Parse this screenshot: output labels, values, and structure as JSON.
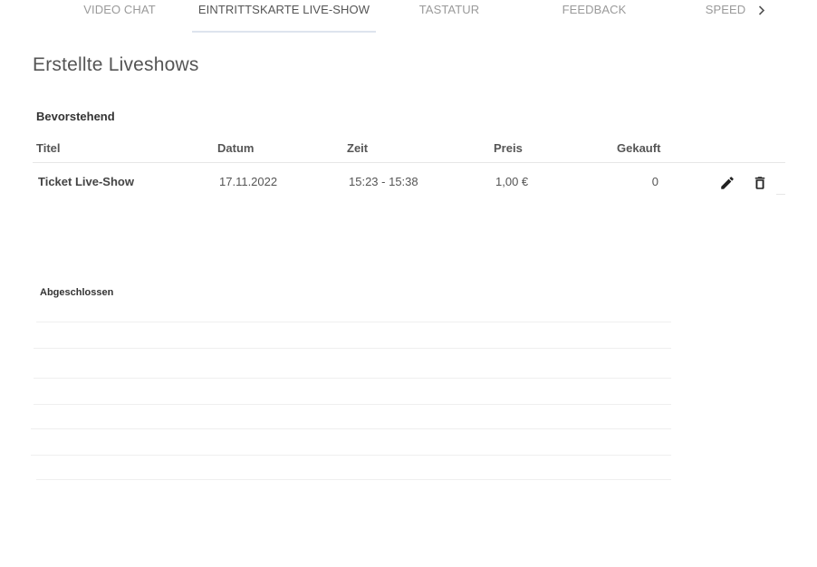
{
  "tabs": [
    {
      "label": "VIDEO CHAT",
      "active": false
    },
    {
      "label": "EINTRITTSKARTE LIVE-SHOW",
      "active": true
    },
    {
      "label": "TASTATUR",
      "active": false
    },
    {
      "label": "FEEDBACK",
      "active": false
    },
    {
      "label": "SPEED",
      "active": false
    }
  ],
  "tab_scroll_icon": "chevron-right-icon",
  "page_title": "Erstellte Liveshows",
  "upcoming": {
    "label": "Bevorstehend",
    "columns": {
      "title": "Titel",
      "date": "Datum",
      "time": "Zeit",
      "price": "Preis",
      "bought": "Gekauft"
    },
    "rows": [
      {
        "title": "Ticket Live-Show",
        "date": "17.11.2022",
        "time": "15:23 - 15:38",
        "price": "1,00 €",
        "bought": "0",
        "actions": [
          "edit-icon",
          "delete-icon"
        ]
      }
    ]
  },
  "completed": {
    "label": "Abgeschlossen",
    "rows": []
  },
  "colors": {
    "tab_inactive": "#9a9a9a",
    "tab_active": "#555555",
    "tab_indicator": "#dde4ee",
    "divider": "#e6e6e6",
    "icon": "#222222"
  }
}
